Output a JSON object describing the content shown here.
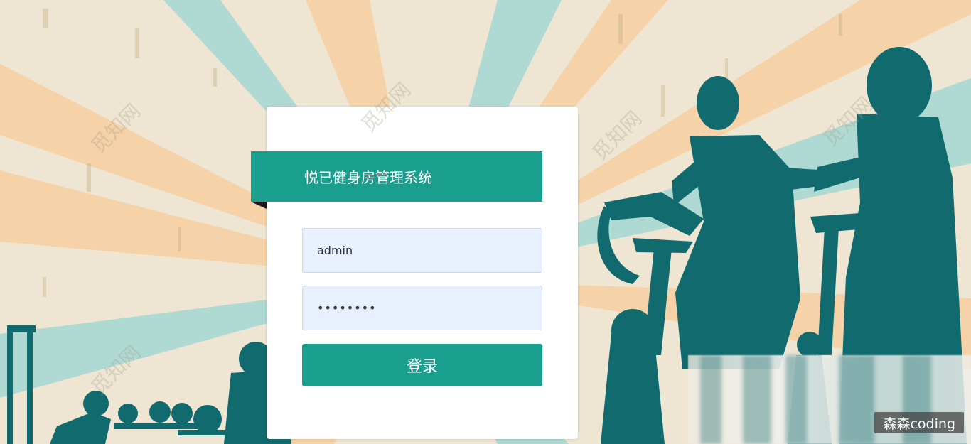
{
  "login": {
    "title": "悦已健身房管理系统",
    "username_value": "admin",
    "password_value": "••••••••",
    "button_label": "登录"
  },
  "corner_badge": "森森coding",
  "watermarks": [
    "觅知网",
    "觅知网",
    "觅知网",
    "觅知网",
    "觅知网"
  ]
}
